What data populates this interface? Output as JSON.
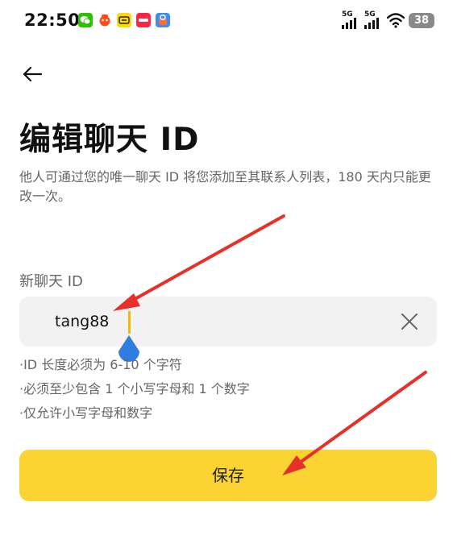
{
  "status_bar": {
    "time": "22:50",
    "signal_1": "5G",
    "signal_2": "5G",
    "battery": "38",
    "app_icons": [
      "wechat-icon",
      "taobao-icon",
      "xianyu-icon",
      "xiaohongshu-icon",
      "app-store-icon"
    ]
  },
  "header": {
    "back_icon": "arrow-left-icon"
  },
  "page": {
    "title": "编辑聊天 ID",
    "description": "他人可通过您的唯一聊天 ID 将您添加至其联系人列表，180 天内只能更改一次。"
  },
  "form": {
    "label": "新聊天 ID",
    "value": "tang88",
    "clear_icon": "close-icon",
    "rules": [
      "·ID 长度必须为 6-10 个字符",
      "·必须至少包含 1 个小写字母和 1 个数字",
      "·仅允许小写字母和数字"
    ]
  },
  "actions": {
    "save_label": "保存"
  },
  "colors": {
    "accent": "#fbd433",
    "caret": "#f5b800",
    "annotation_arrow": "#e8302a",
    "handle": "#2f7de1"
  }
}
